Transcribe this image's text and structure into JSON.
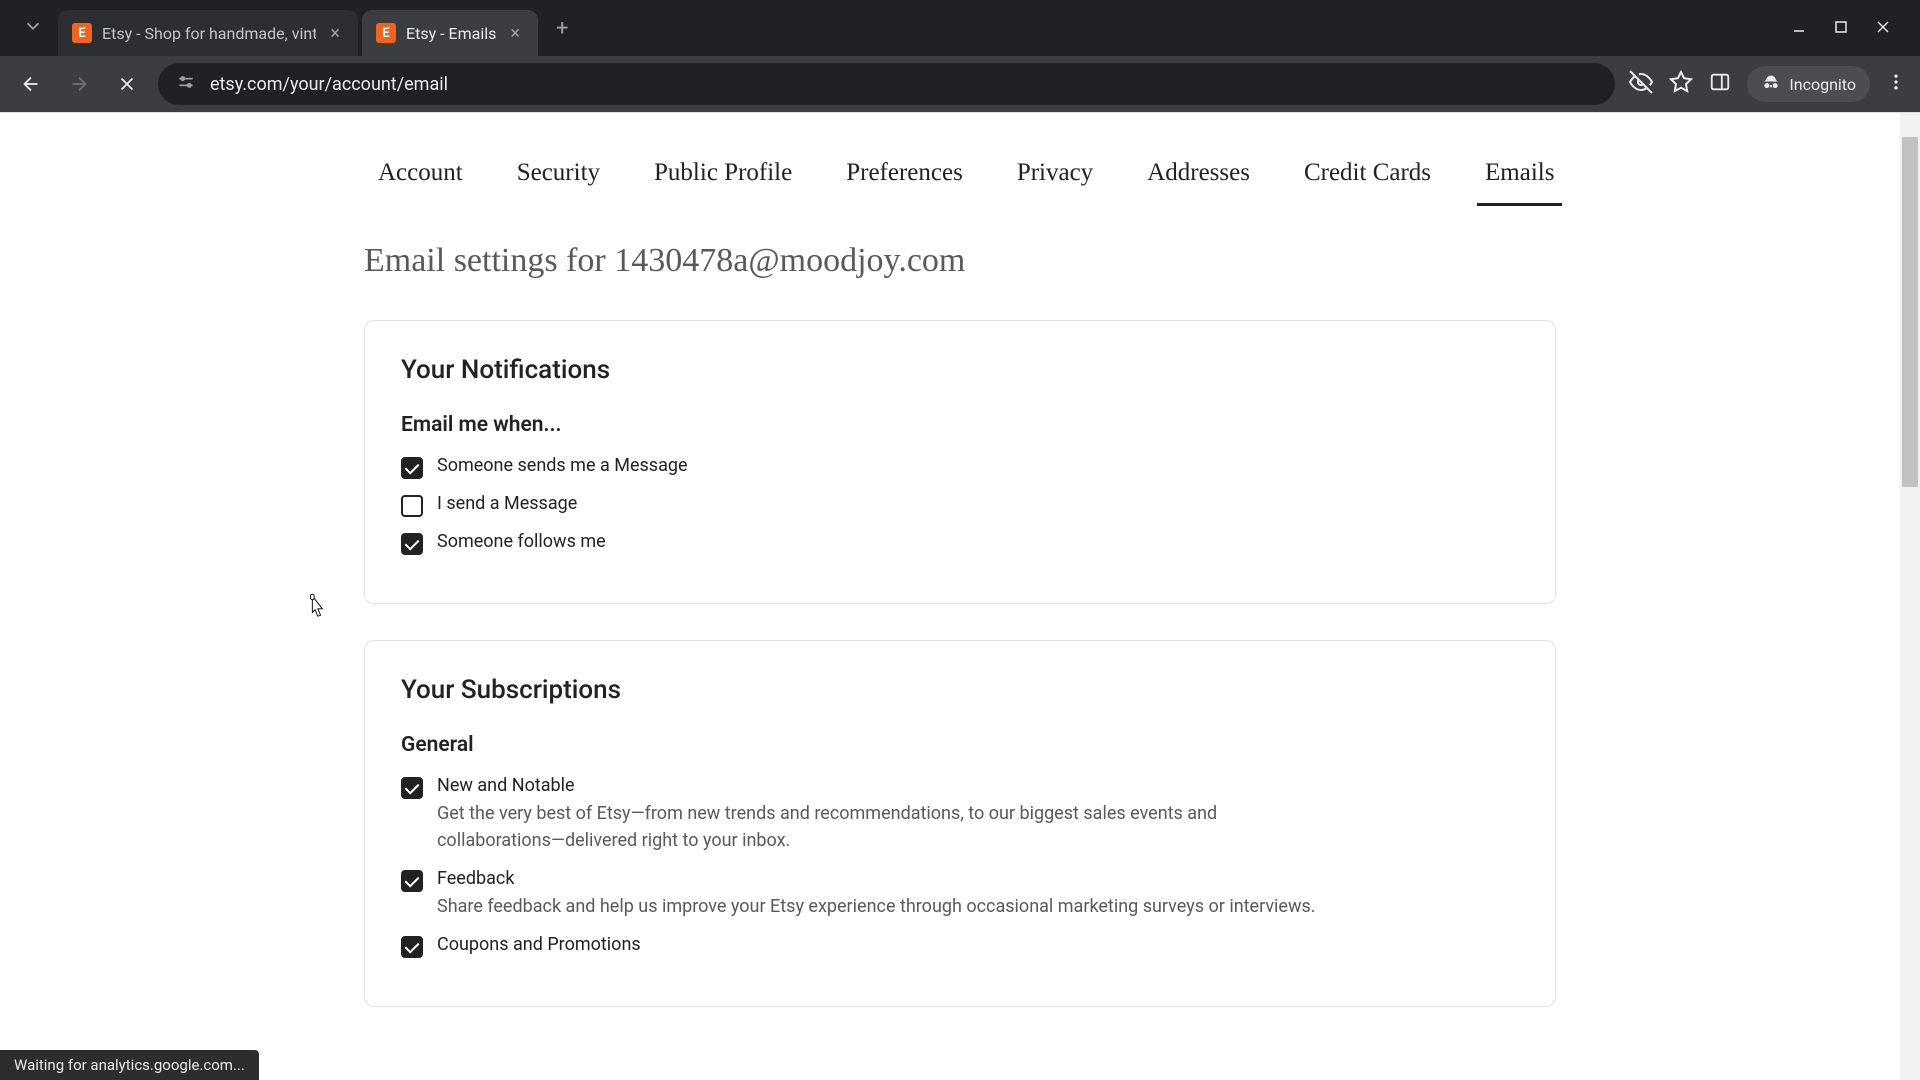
{
  "browser": {
    "tabs": [
      {
        "title": "Etsy - Shop for handmade, vint",
        "active": false
      },
      {
        "title": "Etsy - Emails",
        "active": true
      }
    ],
    "url": "etsy.com/your/account/email",
    "incognito_label": "Incognito",
    "status_bar": "Waiting for analytics.google.com..."
  },
  "nav_tabs": {
    "items": [
      "Account",
      "Security",
      "Public Profile",
      "Preferences",
      "Privacy",
      "Addresses",
      "Credit Cards",
      "Emails"
    ],
    "active": "Emails"
  },
  "page_title": "Email settings for 1430478a@moodjoy.com",
  "notifications": {
    "card_title": "Your Notifications",
    "subtitle": "Email me when...",
    "items": [
      {
        "label": "Someone sends me a Message",
        "checked": true
      },
      {
        "label": "I send a Message",
        "checked": false
      },
      {
        "label": "Someone follows me",
        "checked": true
      }
    ]
  },
  "subscriptions": {
    "card_title": "Your Subscriptions",
    "section_title": "General",
    "items": [
      {
        "label": "New and Notable",
        "desc": "Get the very best of Etsy—from new trends and recommendations, to our biggest sales events and collaborations—delivered right to your inbox.",
        "checked": true
      },
      {
        "label": "Feedback",
        "desc": "Share feedback and help us improve your Etsy experience through occasional marketing surveys or interviews.",
        "checked": true
      },
      {
        "label": "Coupons and Promotions",
        "desc": "",
        "checked": true
      }
    ]
  }
}
